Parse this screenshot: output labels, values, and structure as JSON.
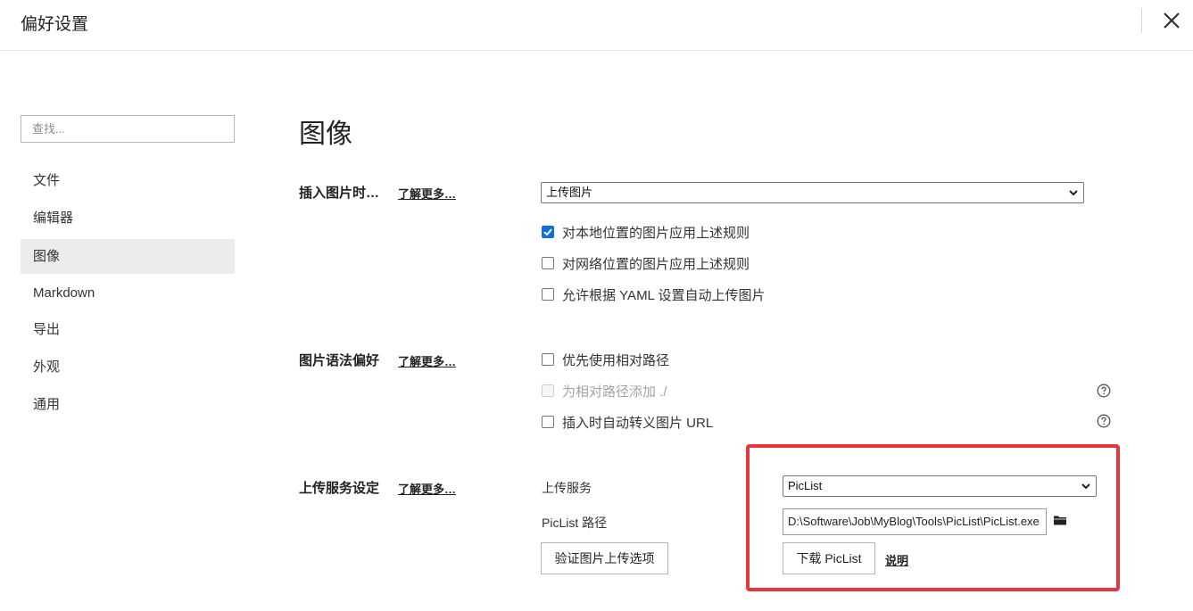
{
  "window": {
    "title": "偏好设置",
    "close_icon": "close-icon"
  },
  "sidebar": {
    "search_placeholder": "查找...",
    "items": [
      {
        "label": "文件",
        "active": false
      },
      {
        "label": "编辑器",
        "active": false
      },
      {
        "label": "图像",
        "active": true
      },
      {
        "label": "Markdown",
        "active": false
      },
      {
        "label": "导出",
        "active": false
      },
      {
        "label": "外观",
        "active": false
      },
      {
        "label": "通用",
        "active": false
      }
    ]
  },
  "main": {
    "title": "图像",
    "insert": {
      "label": "插入图片时…",
      "learn_more": "了解更多…",
      "action_value": "上传图片",
      "options": [
        {
          "label": "对本地位置的图片应用上述规则",
          "checked": true
        },
        {
          "label": "对网络位置的图片应用上述规则",
          "checked": false
        },
        {
          "label": "允许根据 YAML 设置自动上传图片",
          "checked": false
        }
      ]
    },
    "syntax": {
      "label": "图片语法偏好",
      "learn_more": "了解更多…",
      "options": [
        {
          "label": "优先使用相对路径",
          "checked": false,
          "disabled": false
        },
        {
          "label": "为相对路径添加 ./",
          "checked": false,
          "disabled": true
        },
        {
          "label": "插入时自动转义图片 URL",
          "checked": false,
          "disabled": false
        }
      ]
    },
    "upload": {
      "label": "上传服务设定",
      "learn_more": "了解更多…",
      "service_label": "上传服务",
      "service_value": "PicList",
      "path_label": "PicList 路径",
      "path_value": "D:\\Software\\Job\\MyBlog\\Tools\\PicList\\PicList.exe",
      "verify_button": "验证图片上传选项",
      "download_button": "下载 PicList",
      "doc_link": "说明"
    }
  },
  "colors": {
    "accent": "#0a6fe0",
    "highlight_border": "#e8363f",
    "active_nav_bg": "#ececec"
  }
}
